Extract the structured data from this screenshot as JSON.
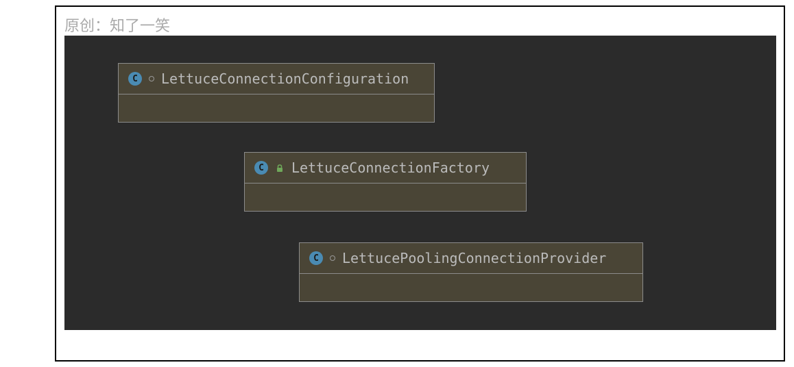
{
  "watermark": "原创：知了一笑",
  "classes": [
    {
      "name": "LettuceConnectionConfiguration",
      "modifier": "package-private",
      "icon": "class"
    },
    {
      "name": "LettuceConnectionFactory",
      "modifier": "public-locked",
      "icon": "class"
    },
    {
      "name": "LettucePoolingConnectionProvider",
      "modifier": "package-private",
      "icon": "class"
    }
  ]
}
